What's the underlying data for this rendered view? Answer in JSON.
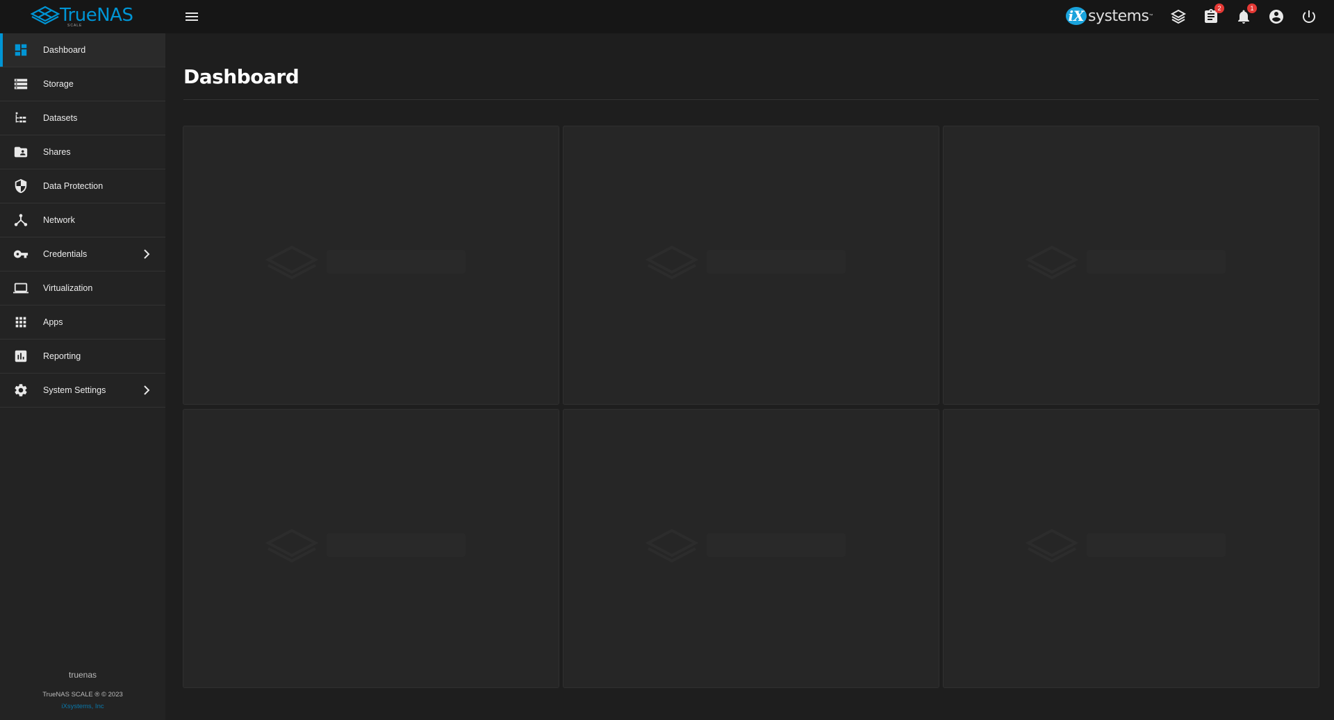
{
  "topbar": {
    "brand_name": "TrueNAS",
    "brand_edition": "SCALE",
    "vendor_logo_ix": "iX",
    "vendor_logo_text": "systems",
    "vendor_logo_tm": "™",
    "icons": [
      "truecommand-icon",
      "jobs-icon",
      "alerts-icon",
      "account-icon",
      "power-icon"
    ],
    "jobs_badge": "2",
    "alerts_badge": "1"
  },
  "sidebar": {
    "items": [
      {
        "label": "Dashboard",
        "icon": "dashboard-icon",
        "active": true
      },
      {
        "label": "Storage",
        "icon": "storage-icon"
      },
      {
        "label": "Datasets",
        "icon": "datasets-icon"
      },
      {
        "label": "Shares",
        "icon": "shares-icon"
      },
      {
        "label": "Data Protection",
        "icon": "shield-icon"
      },
      {
        "label": "Network",
        "icon": "network-icon"
      },
      {
        "label": "Credentials",
        "icon": "key-icon",
        "expandable": true
      },
      {
        "label": "Virtualization",
        "icon": "laptop-icon"
      },
      {
        "label": "Apps",
        "icon": "apps-grid-icon"
      },
      {
        "label": "Reporting",
        "icon": "chart-icon"
      },
      {
        "label": "System Settings",
        "icon": "gear-icon",
        "expandable": true
      }
    ],
    "footer": {
      "hostname": "truenas",
      "version": "TrueNAS SCALE ® © 2023",
      "company": "iXsystems, Inc"
    }
  },
  "main": {
    "title": "Dashboard",
    "cards_loading": 6
  },
  "colors": {
    "accent": "#0095d5",
    "badge": "#e53935",
    "topbar_bg": "#161616",
    "sidebar_bg": "#232323",
    "main_bg": "#1e1e1e",
    "card_bg": "#262626"
  }
}
